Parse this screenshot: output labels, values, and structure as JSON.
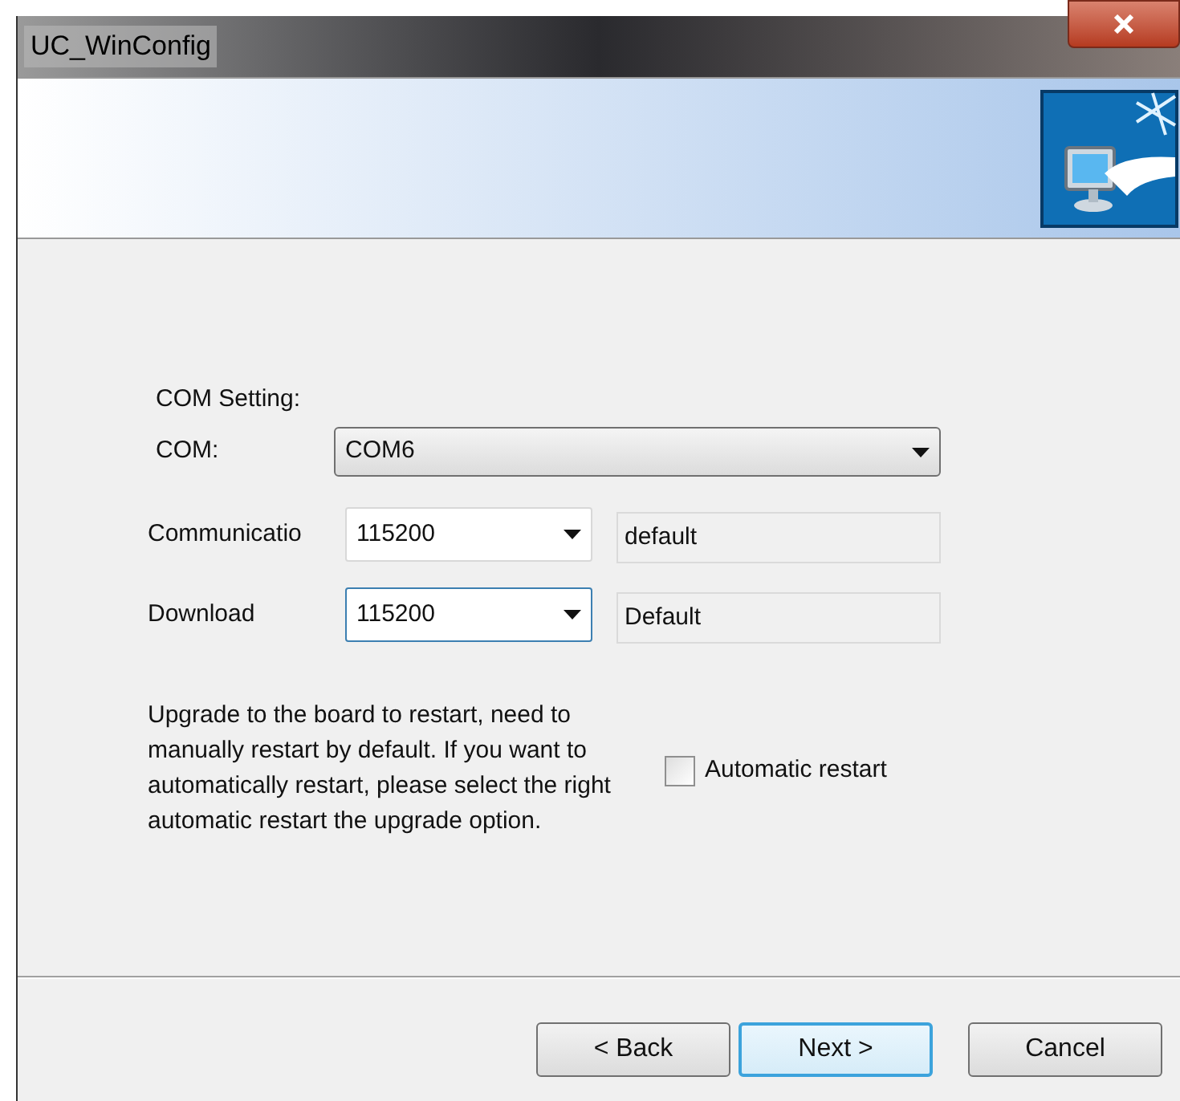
{
  "window": {
    "title": "UC_WinConfig"
  },
  "section_label": "COM Setting:",
  "com": {
    "label": "COM:",
    "value": "COM6"
  },
  "baud_rows": [
    {
      "label": "Communicatio",
      "value": "115200",
      "focused": false,
      "note": "default"
    },
    {
      "label": "Download",
      "value": "115200",
      "focused": true,
      "note": "Default"
    }
  ],
  "description": "Upgrade to the board to restart, need to manually restart by default. If you want to automatically restart, please select the right automatic restart the upgrade option.",
  "auto_restart": {
    "label": "Automatic restart",
    "checked": false
  },
  "buttons": [
    {
      "label": "< Back",
      "default": false
    },
    {
      "label": "Next >",
      "default": true
    },
    {
      "label": "Cancel",
      "default": false
    }
  ]
}
